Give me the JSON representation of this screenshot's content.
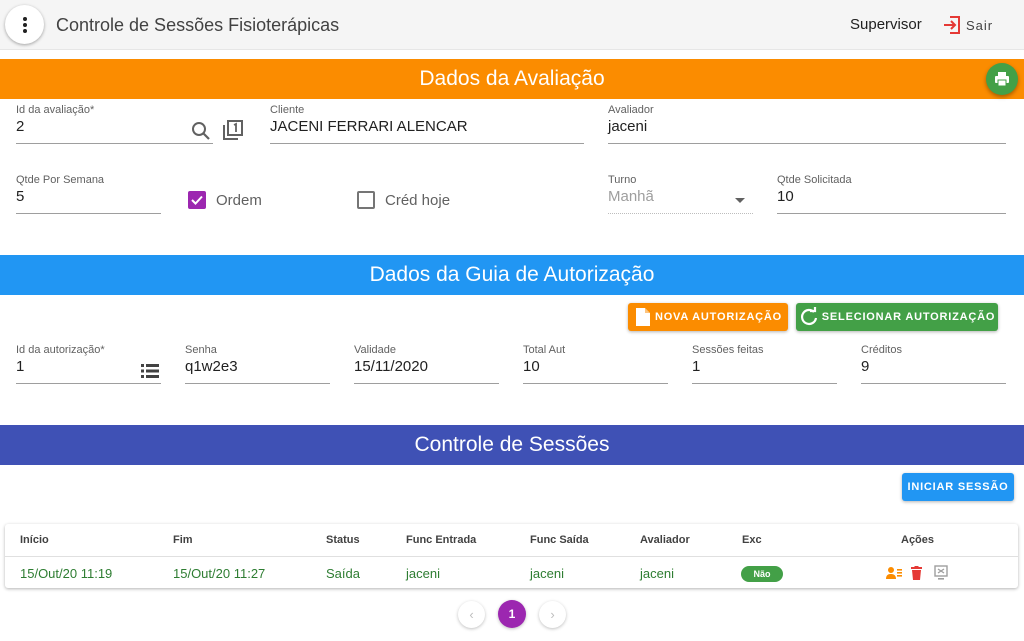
{
  "app": {
    "title": "Controle de Sessões Fisioterápicas",
    "user": "Supervisor",
    "logout_label": "Sair"
  },
  "colors": {
    "orange": "#fb8c00",
    "blue": "#2196f3",
    "indigo": "#3f51b5",
    "green": "#43a047",
    "purple": "#9c27b0",
    "red": "#e53935"
  },
  "avaliacao": {
    "header": "Dados da Avaliação",
    "id": {
      "label": "Id da avaliação*",
      "value": "2"
    },
    "cliente": {
      "label": "Cliente",
      "value": "JACENI FERRARI ALENCAR"
    },
    "avaliador": {
      "label": "Avaliador",
      "value": "jaceni"
    },
    "qtde_semana": {
      "label": "Qtde Por Semana",
      "value": "5"
    },
    "ordem": {
      "label": "Ordem",
      "checked": true
    },
    "cred_hoje": {
      "label": "Créd hoje",
      "checked": false
    },
    "turno": {
      "label": "Turno",
      "value": "Manhã"
    },
    "qtde_solicitada": {
      "label": "Qtde Solicitada",
      "value": "10"
    }
  },
  "guia": {
    "header": "Dados da Guia de Autorização",
    "nova_label": "Nova Autorização",
    "selecionar_label": "Selecionar Autorização",
    "id": {
      "label": "Id da autorização*",
      "value": "1"
    },
    "senha": {
      "label": "Senha",
      "value": "q1w2e3"
    },
    "validade": {
      "label": "Validade",
      "value": "15/11/2020"
    },
    "total_aut": {
      "label": "Total Aut",
      "value": "10"
    },
    "sessoes_feitas": {
      "label": "Sessões feitas",
      "value": "1"
    },
    "creditos": {
      "label": "Créditos",
      "value": "9"
    }
  },
  "sessoes": {
    "header": "Controle de Sessões",
    "iniciar_label": "Iniciar Sessão",
    "columns": [
      "Início",
      "Fim",
      "Status",
      "Func Entrada",
      "Func Saída",
      "Avaliador",
      "Exc",
      "Ações"
    ],
    "rows": [
      {
        "inicio": "15/Out/20 11:19",
        "fim": "15/Out/20 11:27",
        "status": "Saída",
        "func_entrada": "jaceni",
        "func_saida": "jaceni",
        "avaliador": "jaceni",
        "exc": "Não"
      }
    ]
  },
  "pagination": {
    "prev": "‹",
    "current": "1",
    "next": "›"
  }
}
